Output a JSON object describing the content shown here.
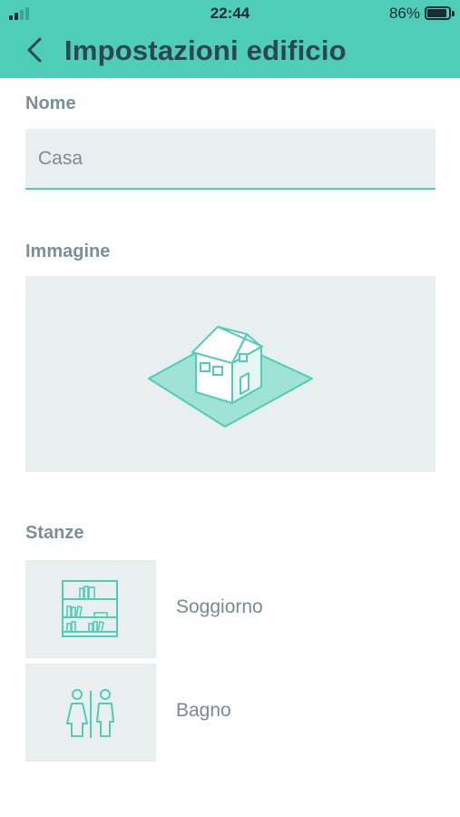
{
  "status_bar": {
    "time": "22:44",
    "battery": "86%"
  },
  "header": {
    "title": "Impostazioni edificio"
  },
  "name_section": {
    "label": "Nome",
    "value": "Casa"
  },
  "image_section": {
    "label": "Immagine"
  },
  "rooms_section": {
    "label": "Stanze",
    "rooms": [
      {
        "label": "Soggiorno",
        "icon": "bookshelf-icon"
      },
      {
        "label": "Bagno",
        "icon": "restroom-icon"
      }
    ]
  },
  "colors": {
    "accent": "#4ECDB8",
    "title": "#2D4654",
    "tile": "#E9EEEE"
  }
}
